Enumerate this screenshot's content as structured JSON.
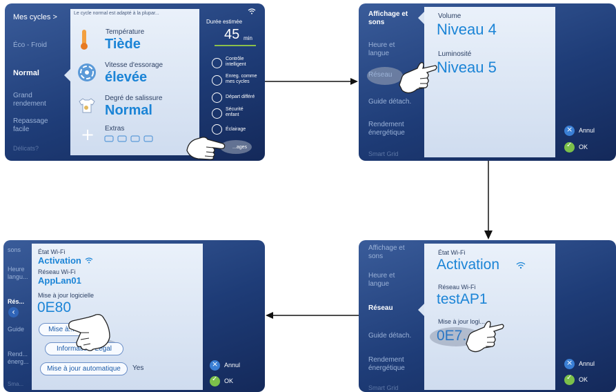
{
  "screen1": {
    "sidebar": [
      "Mes cycles >",
      "Éco - Froid",
      "Normal",
      "Grand\nrendement",
      "Repassage\nfacile",
      "Délicats?"
    ],
    "selected_index": 2,
    "hint": "Le cycle normal est adapté à la plupar...",
    "temperature_label": "Température",
    "temperature_value": "Tiède",
    "spin_label": "Vitesse d'essorage",
    "spin_value": "élevée",
    "soil_label": "Degré de salissure",
    "soil_value": "Normal",
    "extras_label": "Extras",
    "duration_label": "Durée estimée",
    "duration_value": "45",
    "duration_unit": "min",
    "options": [
      {
        "label": "Contrôle\nintelligent",
        "icon": "smart-control-icon"
      },
      {
        "label": "Enreg. comme\nmes cycles",
        "icon": "save-cycle-icon"
      },
      {
        "label": "Départ différé",
        "icon": "delay-start-icon"
      },
      {
        "label": "Sécurité\nenfant",
        "icon": "child-lock-icon"
      },
      {
        "label": "Éclairage",
        "icon": "light-icon"
      }
    ],
    "settings_button": "...ages"
  },
  "screen2": {
    "sidebar": [
      "Affichage et\nsons",
      "Heure et\nlangue",
      "Réseau",
      "Guide détach.",
      "Rendement\nénergétique",
      "Smart Grid"
    ],
    "selected_index": 0,
    "volume_label": "Volume",
    "volume_value": "Niveau 4",
    "brightness_label": "Luminosité",
    "brightness_value": "Niveau 5",
    "cancel": "Annul",
    "ok": "OK"
  },
  "screen3": {
    "sidebar": [
      "Affichage et\nsons",
      "Heure et\nlangue",
      "Réseau",
      "Guide détach.",
      "Rendement\nénergétique",
      "Smart Grid"
    ],
    "selected_index": 2,
    "wifi_state_label": "État Wi-Fi",
    "wifi_state_value": "Activation",
    "network_label": "Réseau Wi-Fi",
    "network_value": "testAP1",
    "update_label": "Mise à jour logi...",
    "update_value": "0E7...",
    "cancel": "Annul",
    "ok": "OK"
  },
  "screen4": {
    "sidebar": [
      "sons",
      "Heure\nlangu...",
      "Rés...",
      "Guide",
      "Rend...\nénerg...",
      "Sma..."
    ],
    "wifi_state_label": "État Wi-Fi",
    "wifi_state_value": "Activation",
    "network_label": "Réseau Wi-Fi",
    "network_value": "AppLan01",
    "update_label": "Mise à jour logicielle",
    "update_value": "0E80",
    "update_button": "Mise à...",
    "info_button": "Informatio... Légal",
    "auto_button": "Mise à jour automatique",
    "auto_value": "Yes",
    "cancel": "Annul",
    "ok": "OK"
  },
  "colors": {
    "accent": "#1b84d6",
    "screen_bg": "#1e3c77",
    "cancel": "#3a7fd5",
    "ok": "#7bc04a"
  }
}
